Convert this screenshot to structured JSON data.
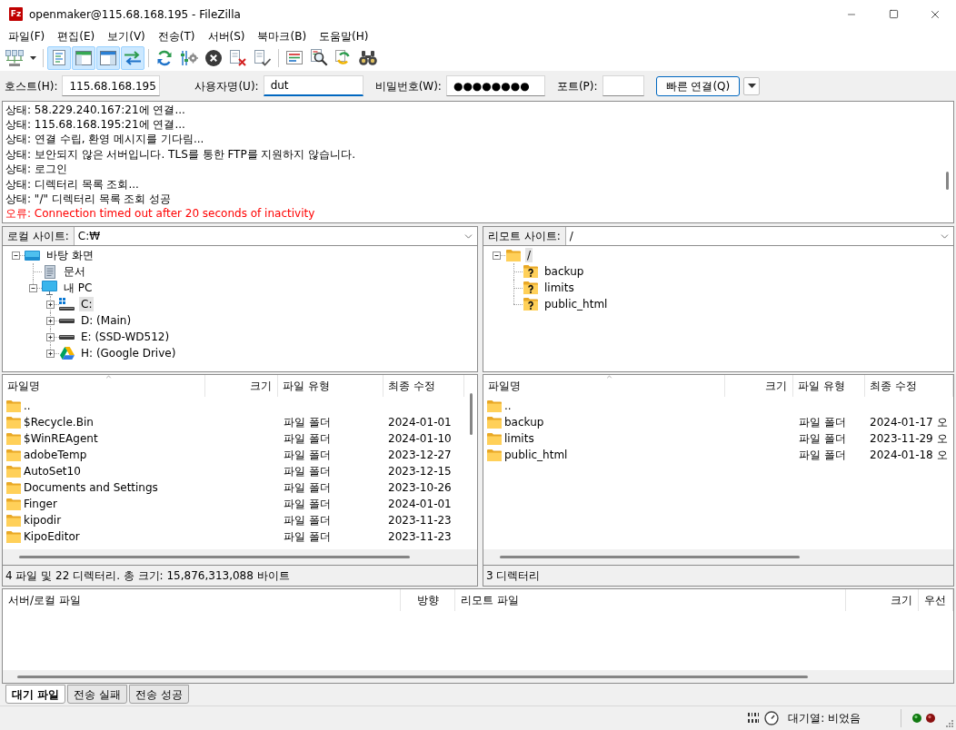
{
  "window": {
    "logo_text": "Fz",
    "title": "openmaker@115.68.168.195 - FileZilla"
  },
  "menu": [
    "파일(F)",
    "편집(E)",
    "보기(V)",
    "전송(T)",
    "서버(S)",
    "북마크(B)",
    "도움말(H)"
  ],
  "toolbar": {
    "view_toggles": [
      {
        "on": true
      },
      {
        "on": true
      },
      {
        "on": true
      },
      {
        "on": true
      }
    ]
  },
  "quickconnect": {
    "host": {
      "label": "호스트(H):",
      "value": "115.68.168.195",
      "focused": false
    },
    "username": {
      "label": "사용자명(U):",
      "value": "dut",
      "focused": true
    },
    "password": {
      "label": "비밀번호(W):",
      "value": "●●●●●●●●",
      "focused": false
    },
    "port": {
      "label": "포트(P):",
      "focused": false
    },
    "connect_button": "빠른 연결(Q)"
  },
  "log": [
    {
      "kind": "status",
      "text": "상태: 58.229.240.167:21에 연결..."
    },
    {
      "kind": "status",
      "text": "상태: 115.68.168.195:21에 연결..."
    },
    {
      "kind": "status",
      "text": "상태: 연결 수립, 환영 메시지를 기다림..."
    },
    {
      "kind": "status",
      "text": "상태: 보안되지 않은 서버입니다. TLS를 통한 FTP를 지원하지 않습니다."
    },
    {
      "kind": "status",
      "text": "상태: 로그인"
    },
    {
      "kind": "status",
      "text": "상태: 디렉터리 목록 조회..."
    },
    {
      "kind": "status",
      "text": "상태: \"/\" 디렉터리 목록 조회 성공"
    },
    {
      "kind": "error",
      "text": "오류: Connection timed out after 20 seconds of inactivity"
    }
  ],
  "local_site": {
    "label": "로컬 사이트:",
    "path": "C:₩"
  },
  "local_tree": [
    {
      "label": "바탕 화면",
      "kind": "desktop",
      "expanded": true,
      "selected": false,
      "children": [
        {
          "label": "문서",
          "kind": "documents",
          "selected": false
        },
        {
          "label": "내 PC",
          "kind": "computer",
          "expanded": true,
          "selected": false,
          "children": [
            {
              "label": "C:",
              "kind": "system-drive",
              "expanded": false,
              "selected": true
            },
            {
              "label": "D: (Main)",
              "kind": "drive",
              "expanded": false,
              "selected": false
            },
            {
              "label": "E: (SSD-WD512)",
              "kind": "drive",
              "expanded": false,
              "selected": false
            },
            {
              "label": "H: (Google Drive)",
              "kind": "cloud-drive",
              "expanded": false,
              "selected": false
            }
          ]
        }
      ]
    }
  ],
  "remote_site": {
    "label": "리모트 사이트:",
    "path": "/"
  },
  "remote_tree": [
    {
      "label": "/",
      "kind": "folder",
      "expanded": true,
      "selected": true,
      "children": [
        {
          "label": "backup",
          "kind": "unknown-folder",
          "selected": false
        },
        {
          "label": "limits",
          "kind": "unknown-folder",
          "selected": false
        },
        {
          "label": "public_html",
          "kind": "unknown-folder",
          "selected": false
        }
      ]
    }
  ],
  "local_files": {
    "columns": [
      {
        "label": "파일명",
        "sorted": true
      },
      {
        "label": "크기",
        "sorted": false
      },
      {
        "label": "파일 유형",
        "sorted": false
      },
      {
        "label": "최종 수정",
        "sorted": false
      }
    ],
    "rows": [
      {
        "name": ".."
      },
      {
        "name": "$Recycle.Bin",
        "type": "파일 폴더",
        "modified": "2024-01-01"
      },
      {
        "name": "$WinREAgent",
        "type": "파일 폴더",
        "modified": "2024-01-10"
      },
      {
        "name": "adobeTemp",
        "type": "파일 폴더",
        "modified": "2023-12-27"
      },
      {
        "name": "AutoSet10",
        "type": "파일 폴더",
        "modified": "2023-12-15"
      },
      {
        "name": "Documents and Settings",
        "type": "파일 폴더",
        "modified": "2023-10-26"
      },
      {
        "name": "Finger",
        "type": "파일 폴더",
        "modified": "2024-01-01"
      },
      {
        "name": "kipodir",
        "type": "파일 폴더",
        "modified": "2023-11-23"
      },
      {
        "name": "KipoEditor",
        "type": "파일 폴더",
        "modified": "2023-11-23"
      }
    ],
    "status": "4 파일 및 22 디렉터리. 총 크기: 15,876,313,088 바이트"
  },
  "remote_files": {
    "columns": [
      {
        "label": "파일명",
        "sorted": true
      },
      {
        "label": "크기",
        "sorted": false
      },
      {
        "label": "파일 유형",
        "sorted": false
      },
      {
        "label": "최종 수정",
        "sorted": false
      }
    ],
    "rows": [
      {
        "name": ".."
      },
      {
        "name": "backup",
        "type": "파일 폴더",
        "modified": "2024-01-17 오"
      },
      {
        "name": "limits",
        "type": "파일 폴더",
        "modified": "2023-11-29 오"
      },
      {
        "name": "public_html",
        "type": "파일 폴더",
        "modified": "2024-01-18 오"
      }
    ],
    "status": "3 디렉터리"
  },
  "queue": {
    "columns": [
      "서버/로컬 파일",
      "방향",
      "리모트 파일",
      "크기",
      "우선"
    ]
  },
  "queue_tabs": [
    {
      "label": "대기 파일",
      "selected": true
    },
    {
      "label": "전송 실패",
      "selected": false
    },
    {
      "label": "전송 성공",
      "selected": false
    }
  ],
  "status_bar": {
    "queue": "대기열: 비었음"
  }
}
